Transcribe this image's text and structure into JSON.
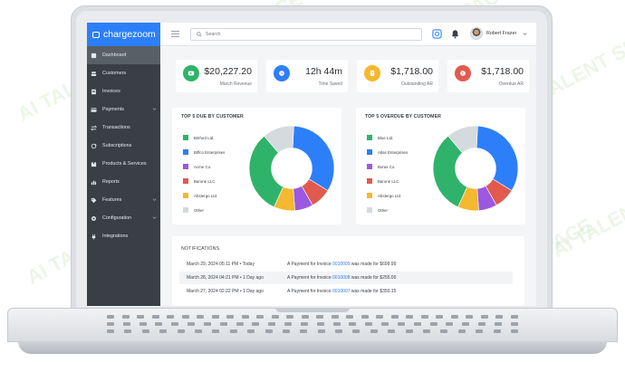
{
  "brand": {
    "name": "chargezoom"
  },
  "sidebar": {
    "items": [
      {
        "label": "Dashboard",
        "icon": "dashboard-icon",
        "active": true,
        "has_submenu": false
      },
      {
        "label": "Customers",
        "icon": "users-icon",
        "active": false,
        "has_submenu": false
      },
      {
        "label": "Invoices",
        "icon": "invoice-icon",
        "active": false,
        "has_submenu": false
      },
      {
        "label": "Payments",
        "icon": "credit-card-icon",
        "active": false,
        "has_submenu": true
      },
      {
        "label": "Transactions",
        "icon": "transfer-icon",
        "active": false,
        "has_submenu": false
      },
      {
        "label": "Subscriptions",
        "icon": "refresh-icon",
        "active": false,
        "has_submenu": false
      },
      {
        "label": "Products & Services",
        "icon": "box-icon",
        "active": false,
        "has_submenu": false
      },
      {
        "label": "Reports",
        "icon": "report-icon",
        "active": false,
        "has_submenu": false
      },
      {
        "label": "Features",
        "icon": "tag-icon",
        "active": false,
        "has_submenu": true
      },
      {
        "label": "Configuration",
        "icon": "gear-icon",
        "active": false,
        "has_submenu": true
      },
      {
        "label": "Integrations",
        "icon": "plug-icon",
        "active": false,
        "has_submenu": false
      }
    ]
  },
  "topbar": {
    "search_placeholder": "Search",
    "user_name": "Robert Frazer"
  },
  "stats": [
    {
      "value": "$20,227.20",
      "label": "March Revenue",
      "color": "#2fb36a",
      "icon": "play-icon"
    },
    {
      "value": "12h 44m",
      "label": "Time Saved",
      "color": "#2d7ff9",
      "icon": "clock-icon"
    },
    {
      "value": "$1,718.00",
      "label": "Outstanding AR",
      "color": "#f5b82e",
      "icon": "document-icon"
    },
    {
      "value": "$1,718.00",
      "label": "Overdue AR",
      "color": "#e25a4f",
      "icon": "alert-icon"
    }
  ],
  "panels": [
    {
      "title": "TOP 5 DUE BY CUSTOMER",
      "legend": [
        {
          "label": "Binford Ltd.",
          "color": "#2fb36a"
        },
        {
          "label": "Biffco Enterprises",
          "color": "#2d7ff9"
        },
        {
          "label": "Acme Co.",
          "color": "#9b59e0"
        },
        {
          "label": "Barone LLC.",
          "color": "#e25a4f"
        },
        {
          "label": "Abstergo Ltd.",
          "color": "#f5b82e"
        },
        {
          "label": "Other",
          "color": "#d5dadf"
        }
      ],
      "slices": [
        {
          "color": "#2d7ff9",
          "value": 33
        },
        {
          "color": "#e25a4f",
          "value": 8
        },
        {
          "color": "#9b59e0",
          "value": 7
        },
        {
          "color": "#f5b82e",
          "value": 8
        },
        {
          "color": "#2fb36a",
          "value": 32
        },
        {
          "color": "#d5dadf",
          "value": 12
        }
      ]
    },
    {
      "title": "TOP 5 OVERDUE BY CUSTOMER",
      "legend": [
        {
          "label": "Blue Ltd.",
          "color": "#2fb36a"
        },
        {
          "label": "Atlas Enterprises",
          "color": "#2d7ff9"
        },
        {
          "label": "Borax Co.",
          "color": "#9b59e0"
        },
        {
          "label": "Barone LLC.",
          "color": "#e25a4f"
        },
        {
          "label": "Abstergo Ltd.",
          "color": "#f5b82e"
        },
        {
          "label": "Other",
          "color": "#d5dadf"
        }
      ],
      "slices": [
        {
          "color": "#2d7ff9",
          "value": 33
        },
        {
          "color": "#e25a4f",
          "value": 8
        },
        {
          "color": "#9b59e0",
          "value": 7
        },
        {
          "color": "#f5b82e",
          "value": 8
        },
        {
          "color": "#2fb36a",
          "value": 32
        },
        {
          "color": "#d5dadf",
          "value": 12
        }
      ]
    }
  ],
  "notifications": {
    "title": "NOTIFICATIONS",
    "rows": [
      {
        "date": "March 29, 2024 05:11 PM • Today",
        "prefix": "A Payment for Invoice ",
        "invoice": "0010009",
        "suffix": " was made for $699.99"
      },
      {
        "date": "March 28, 2024 04:21 PM • 1 Day ago",
        "prefix": "A Payment for Invoice ",
        "invoice": "0010008",
        "suffix": " was made for $255.00"
      },
      {
        "date": "March 27, 2024 02:22 PM • 1 Day ago",
        "prefix": "A Payment for Invoice ",
        "invoice": "0010007",
        "suffix": " was made for $350.15"
      }
    ]
  },
  "watermark": {
    "text": "AI TALENT SPACE"
  }
}
